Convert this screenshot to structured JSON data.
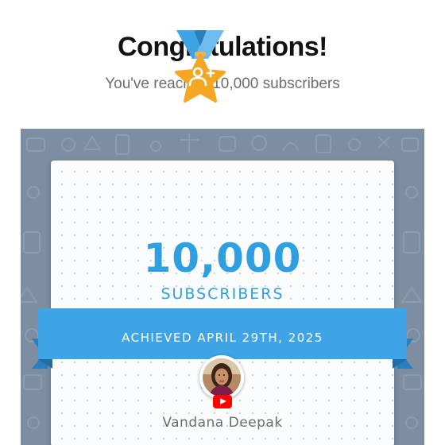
{
  "header": {
    "title": "Congratulations!",
    "subtitle": "You've reached 10,000 subscribers"
  },
  "card": {
    "milestone_number": "10,000",
    "milestone_unit": "SUBSCRIBERS",
    "achieved_text": "ACHIEVED APRIL 29TH, 2025",
    "channel_name": "Vandana Deepak",
    "badge_icon": "add-person-icon"
  },
  "colors": {
    "accent": "#2e9fe0",
    "ribbon": "#3ea4e6",
    "ribbon_dark": "#2a7fba",
    "star": "#f5a623",
    "panel_bg": "#7e8ea1",
    "youtube_red": "#ff0000"
  }
}
